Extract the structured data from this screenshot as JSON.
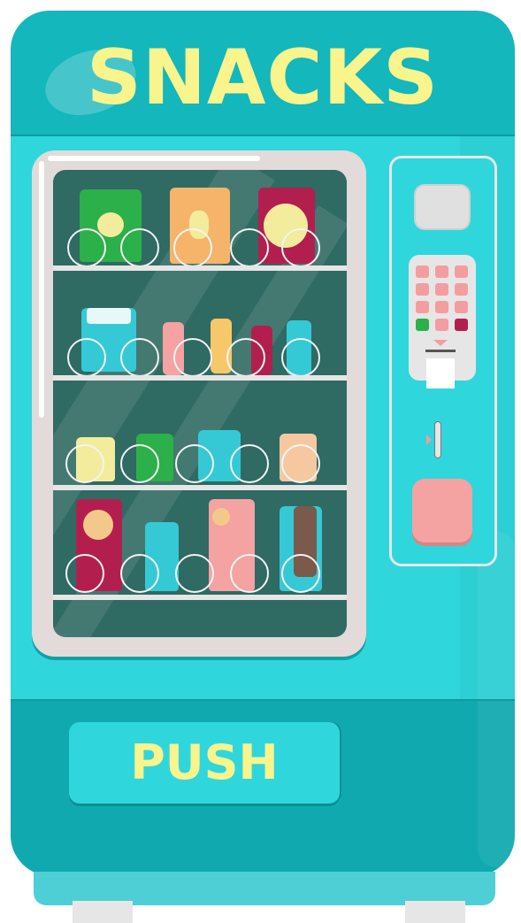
{
  "header": {
    "title": "SNACKS"
  },
  "door": {
    "push_label": "PUSH"
  },
  "colors": {
    "body": "#2fd7dc",
    "body_dark": "#13b7bc",
    "title_text": "#f9f48c",
    "glass": "#2f6a63",
    "frame": "#e3dada",
    "key": "#f49da0",
    "key_green": "#2bb04a",
    "key_red": "#b21f4e"
  },
  "shelves": [
    {
      "items": [
        "green-chip-bag-icon",
        "orange-chip-bag-icon",
        "red-chip-bag-icon"
      ]
    },
    {
      "items": [
        "chip-bag-icon",
        "drink-can-icon",
        "drink-can-icon",
        "drink-can-icon",
        "drink-can-icon"
      ]
    },
    {
      "items": [
        "candy-bag-icon",
        "cookie-bag-icon",
        "candy-bag-icon",
        "candy-bag-icon"
      ]
    },
    {
      "items": [
        "cookie-box-icon",
        "cracker-box-icon",
        "cookie-box-icon",
        "cookie-box-icon"
      ]
    }
  ],
  "keypad": {
    "rows": 4,
    "cols": 3
  }
}
